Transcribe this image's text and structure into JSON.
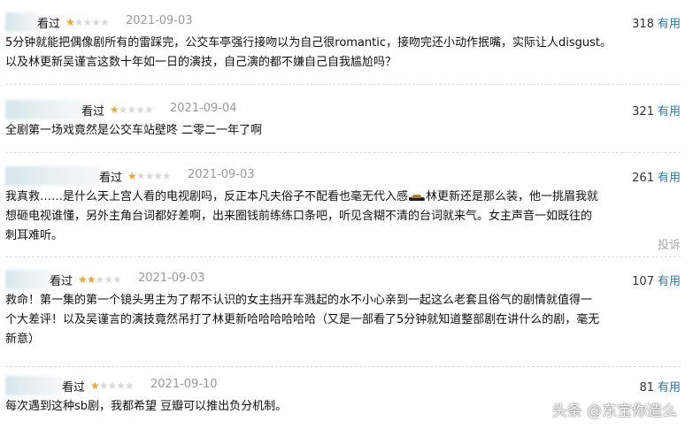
{
  "reviews": [
    {
      "status": "看过",
      "rating": 1,
      "date": "2021-09-03",
      "votes": "318",
      "vote_label": "有用",
      "lines": [
        "5分钟就能把偶像剧所有的雷踩完，公交车亭强行接吻以为自己很romantic，接吻完还小动作抿嘴，实际让人disgust。",
        "以及林更新吴谨言这数十年如一日的演技，自己演的都不嫌自己自我尴尬吗？"
      ]
    },
    {
      "status": "看过",
      "rating": 1,
      "date": "2021-09-04",
      "votes": "321",
      "vote_label": "有用",
      "lines": [
        "全剧第一场戏竟然是公交车站壁咚 二零二一年了啊"
      ]
    },
    {
      "status": "看过",
      "rating": 1,
      "date": "2021-09-03",
      "votes": "261",
      "vote_label": "有用",
      "line1_before": "我真救……是什么天上宫人看的电视剧吗，反正本凡夫俗子不配看也毫无代入感",
      "line1_after": "林更新还是那么装，他一挑眉我就",
      "lines": [
        "想砸电视谁懂，另外主角台词都好差啊，出来圈钱前练练口条吧，听见含糊不清的台词就来气。女主声音一如既往的",
        "刺耳难听。"
      ],
      "report_label": "投诉"
    },
    {
      "status": "看过",
      "rating": 2,
      "date": "2021-09-03",
      "votes": "107",
      "vote_label": "有用",
      "lines": [
        "救命！第一集的第一个镜头男主为了帮不认识的女主挡开车溅起的水不小心亲到一起这么老套且俗气的剧情就值得一",
        "个大差评！以及吴谨言的演技竟然吊打了林更新哈哈哈哈哈哈（又是一部看了5分钟就知道整部剧在讲什么的剧，毫无",
        "新意）"
      ]
    },
    {
      "status": "看过",
      "rating": 1,
      "date": "2021-09-10",
      "votes": "81",
      "vote_label": "有用",
      "lines": [
        "每次遇到这种sb剧，我都希望 豆瓣可以推出负分机制。"
      ]
    }
  ],
  "watermark": "头条 @东宝你造么",
  "colors": {
    "star": "#f5a623",
    "link": "#3377aa",
    "date": "#999999"
  }
}
